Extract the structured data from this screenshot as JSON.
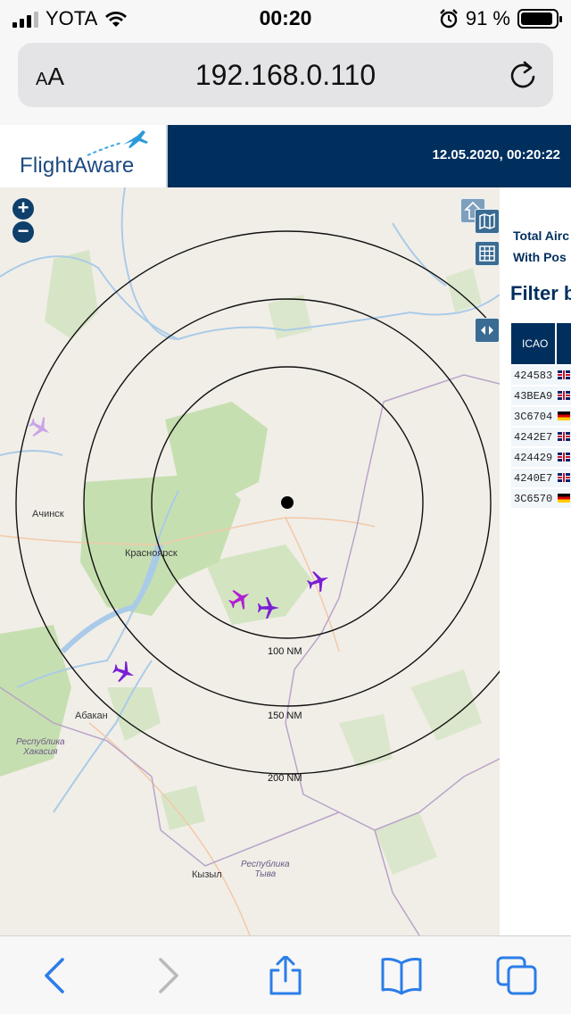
{
  "status_bar": {
    "carrier": "YOTA",
    "time": "00:20",
    "battery": "91 %",
    "battery_level": 0.91,
    "icons": [
      "signal-icon",
      "wifi-icon",
      "alarm-icon",
      "battery-icon"
    ]
  },
  "browser": {
    "text_size_label_small": "A",
    "text_size_label_large": "A",
    "url": "192.168.0.110",
    "toolbar": [
      "back-icon",
      "forward-icon",
      "share-icon",
      "bookmarks-icon",
      "tabs-icon"
    ]
  },
  "header": {
    "brand": "FlightAware",
    "datetime": "12.05.2020, 00:20:22"
  },
  "map": {
    "controls": [
      "zoom-in-icon",
      "zoom-out-icon",
      "layers-icon",
      "map-icon",
      "grid-icon",
      "toggle-panel-icon"
    ],
    "zoom_in": "+",
    "zoom_out": "−",
    "range_rings": [
      {
        "label": "100 NM"
      },
      {
        "label": "150 NM"
      },
      {
        "label": "200 NM"
      }
    ],
    "cities": [
      {
        "name": "Ачинск"
      },
      {
        "name": "Красноярск"
      },
      {
        "name": "Абакан"
      },
      {
        "name": "Кызыл"
      }
    ],
    "regions": [
      {
        "line1": "Республика",
        "line2": "Хакасия"
      },
      {
        "line1": "Республика",
        "line2": "Тыва"
      }
    ],
    "colors": {
      "plane": "#7a1fd6",
      "plane_faded": "#c9a4e8",
      "ring": "#111111",
      "forest": "#c6dfb0"
    }
  },
  "panel": {
    "total_label": "Total Airc",
    "with_pos_label": "With Pos",
    "filter_label": "Filter b",
    "table": {
      "headers": [
        "ICAO",
        ""
      ],
      "rows": [
        {
          "icao": "424583",
          "flag": "gb"
        },
        {
          "icao": "43BEA9",
          "flag": "gb"
        },
        {
          "icao": "3C6704",
          "flag": "de"
        },
        {
          "icao": "4242E7",
          "flag": "gb"
        },
        {
          "icao": "424429",
          "flag": "gb"
        },
        {
          "icao": "4240E7",
          "flag": "gb"
        },
        {
          "icao": "3C6570",
          "flag": "de"
        }
      ]
    }
  }
}
